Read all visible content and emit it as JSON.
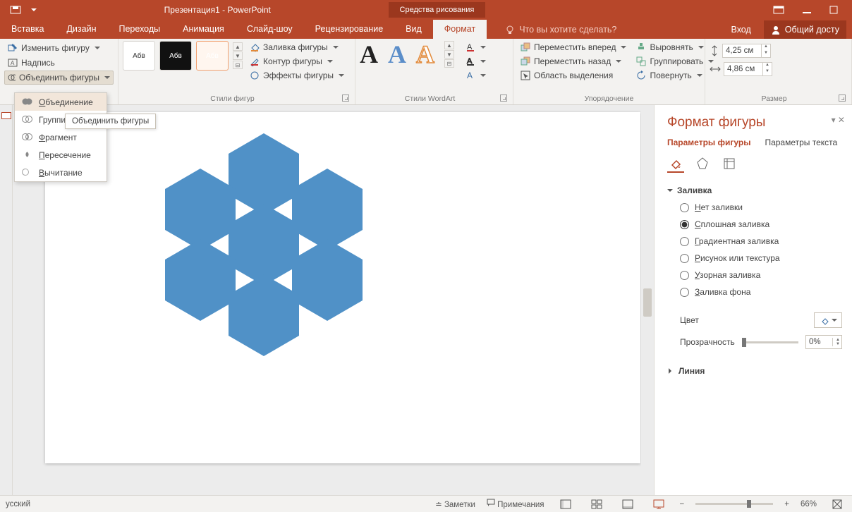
{
  "title": "Презентация1 - PowerPoint",
  "context_tab": "Средства рисования",
  "tabs": [
    "Вставка",
    "Дизайн",
    "Переходы",
    "Анимация",
    "Слайд-шоу",
    "Рецензирование",
    "Вид",
    "Формат"
  ],
  "tell_me": "Что вы хотите сделать?",
  "signin": "Вход",
  "share": "Общий досту",
  "ribbon": {
    "insert_shapes": {
      "edit_shape": "Изменить фигуру",
      "text_box": "Надпись",
      "merge_shapes": "Объединить фигуры"
    },
    "shape_styles": {
      "label": "Стили фигур",
      "thumb_text": "Абв",
      "fill": "Заливка фигуры",
      "outline": "Контур фигуры",
      "effects": "Эффекты фигуры"
    },
    "wordart": {
      "label": "Стили WordArt",
      "glyph": "A"
    },
    "arrange": {
      "label": "Упорядочение",
      "bring_fwd": "Переместить вперед",
      "send_back": "Переместить назад",
      "selection": "Область выделения",
      "align": "Выровнять",
      "group": "Группировать",
      "rotate": "Повернуть"
    },
    "size": {
      "label": "Размер",
      "h": "4,25 см",
      "w": "4,86 см"
    }
  },
  "merge_menu": {
    "items": [
      "Объединение",
      "Группи",
      "Фрагмент",
      "Пересечение",
      "Вычитание"
    ],
    "tooltip": "Объединить фигуры"
  },
  "format_pane": {
    "title": "Формат фигуры",
    "tab1": "Параметры фигуры",
    "tab2": "Параметры текста",
    "section_fill": "Заливка",
    "fills": [
      "Нет заливки",
      "Сплошная заливка",
      "Градиентная заливка",
      "Рисунок или текстура",
      "Узорная заливка",
      "Заливка фона"
    ],
    "selected_fill": 1,
    "color": "Цвет",
    "transparency": "Прозрачность",
    "transparency_val": "0%",
    "section_line": "Линия"
  },
  "status": {
    "lang": "усский",
    "notes": "Заметки",
    "comments": "Примечания",
    "zoom": "66%"
  }
}
